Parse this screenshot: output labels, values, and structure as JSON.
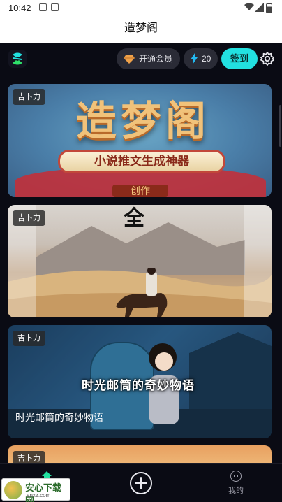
{
  "status_bar": {
    "time": "10:42"
  },
  "title_bar": {
    "title": "造梦阁"
  },
  "top_bar": {
    "vip_label": "开通会员",
    "energy_count": "20",
    "signin_label": "签到"
  },
  "feed": {
    "cards": [
      {
        "tag": "吉卜力",
        "banner_title": "造梦阁",
        "banner_subtitle": "小说推文生成神器",
        "banner_stub": "创作",
        "caption": ""
      },
      {
        "tag": "吉卜力",
        "overlay_text": "全",
        "caption": ""
      },
      {
        "tag": "吉卜力",
        "overlay_text": "时光邮筒的奇妙物语",
        "caption": "时光邮筒的奇妙物语"
      },
      {
        "tag": "吉卜力",
        "caption": ""
      }
    ]
  },
  "bottom_nav": {
    "home_label": "首页",
    "me_label": "我的"
  },
  "watermark": {
    "text": "安心下载网",
    "url": "anxz.com"
  },
  "colors": {
    "accent": "#22e0e0",
    "background": "#0a0b14"
  }
}
